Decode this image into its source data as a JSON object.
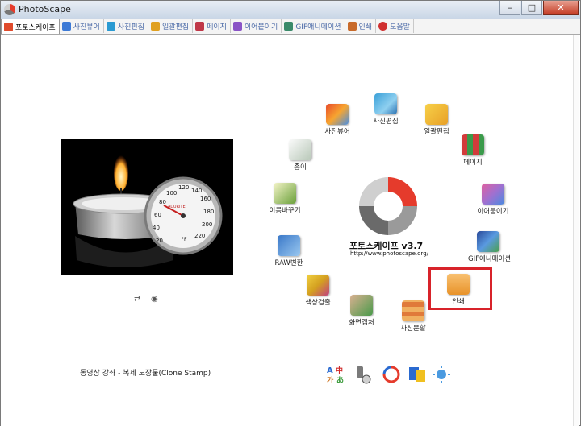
{
  "window": {
    "title": "PhotoScape",
    "minimize": "–",
    "maximize": "□",
    "close": "✕"
  },
  "tabs": [
    {
      "label": "포토스케이프",
      "color": "#e04b2c"
    },
    {
      "label": "사진뷰어",
      "color": "#3d7ad6"
    },
    {
      "label": "사진편집",
      "color": "#2a9ad2"
    },
    {
      "label": "일괄편집",
      "color": "#e0a020"
    },
    {
      "label": "페이지",
      "color": "#c03848"
    },
    {
      "label": "이어붙이기",
      "color": "#8a54c6"
    },
    {
      "label": "GIF애니메이션",
      "color": "#3a8a6a"
    },
    {
      "label": "인쇄",
      "color": "#c86a2a"
    },
    {
      "label": "도움말",
      "color": "#d03030"
    }
  ],
  "left_panel": {
    "mini_icons": [
      "⇄",
      "◉"
    ],
    "caption": "동영상 강좌 - 복제 도장툴(Clone Stamp)"
  },
  "thermometer": [
    "20",
    "40",
    "60",
    "80",
    "100",
    "120",
    "140",
    "160",
    "180",
    "200",
    "220"
  ],
  "thermometer_brand": "ACURITE",
  "thermometer_unit": "°F",
  "hub": {
    "items": [
      {
        "label": "사진뷰어",
        "color": "#4b8fe0"
      },
      {
        "label": "사진편집",
        "color": "#3aa0d8"
      },
      {
        "label": "일괄편집",
        "color": "#e8b028"
      },
      {
        "label": "페이지",
        "color": "#d23b3b"
      },
      {
        "label": "이어붙이기",
        "color": "#a070d0"
      },
      {
        "label": "GIF애니메이션",
        "color": "#3a6ac0"
      },
      {
        "label": "인쇄",
        "color": "#e8932a"
      },
      {
        "label": "사진분할",
        "color": "#e07a3a"
      },
      {
        "label": "화면캡처",
        "color": "#4a9a4a"
      },
      {
        "label": "색상검출",
        "color": "#d4a020"
      },
      {
        "label": "RAW변환",
        "color": "#3a78c8"
      },
      {
        "label": "이름바꾸기",
        "color": "#6aa03a"
      },
      {
        "label": "종이",
        "color": "#7a9a7a"
      }
    ],
    "logo_name": "포토스케이프 v3.7",
    "logo_url": "http://www.photoscape.org/"
  },
  "bottom_icons": [
    "language-icon",
    "tools-icon",
    "refresh-icon",
    "sticker-icon",
    "weather-icon"
  ],
  "bottom_text": {
    "lang_a": "A",
    "lang_zhong": "中",
    "lang_ga": "가",
    "lang_a2": "あ"
  }
}
